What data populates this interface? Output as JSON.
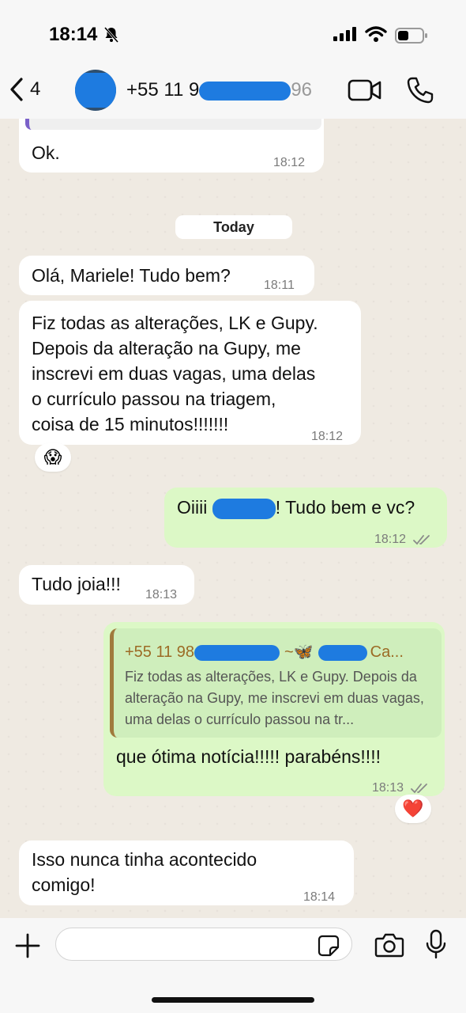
{
  "status": {
    "time": "18:14"
  },
  "header": {
    "back_count": "4",
    "contact_visible": "+55 11 9",
    "contact_tail": "96"
  },
  "messages": {
    "m0": {
      "text": "Ok.",
      "time": "18:12"
    },
    "date_pill": "Today",
    "m1": {
      "text": "Olá, Mariele! Tudo bem?",
      "time": "18:11"
    },
    "m2": {
      "lines": [
        "Fiz todas as alterações, LK e Gupy.",
        "Depois da alteração na Gupy, me",
        "inscrevi em duas vagas, uma delas",
        "o currículo passou na triagem,",
        "coisa de 15 minutos!!!!!!!"
      ],
      "time": "18:12",
      "reaction": "😱"
    },
    "m3": {
      "prefix": "Oiiii",
      "suffix": "! Tudo bem e vc?",
      "time": "18:12"
    },
    "m4": {
      "text": "Tudo joia!!!",
      "time": "18:13"
    },
    "m5": {
      "quote_author_prefix": "+55 11 98",
      "quote_author_mid": "~🦋",
      "quote_author_suffix": "Ca...",
      "quote_text": "Fiz todas as alterações, LK e Gupy. Depois da alteração na Gupy, me inscrevi em duas vagas, uma delas o currículo passou na tr...",
      "text": "que ótima notícia!!!!! parabéns!!!!",
      "time": "18:13",
      "reaction": "❤️"
    },
    "m6": {
      "lines": [
        "Isso nunca tinha acontecido",
        "comigo!"
      ],
      "time": "18:14"
    }
  },
  "input": {
    "placeholder": ""
  },
  "colors": {
    "incoming": "#ffffff",
    "outgoing": "#dcf8c6",
    "redaction": "#1e7be0",
    "background": "#efeae2"
  }
}
